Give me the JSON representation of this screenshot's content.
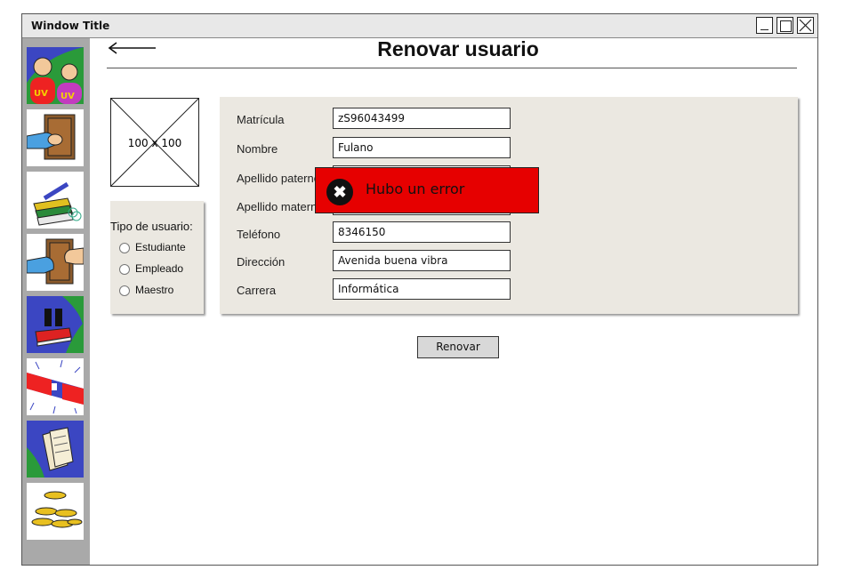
{
  "window": {
    "title": "Window Title"
  },
  "sidebar": {
    "items": [
      {
        "icon": "users-icon"
      },
      {
        "icon": "book-hand-icon"
      },
      {
        "icon": "books-pen-icon"
      },
      {
        "icon": "book-exchange-icon"
      },
      {
        "icon": "pause-book-icon"
      },
      {
        "icon": "alarm-icon"
      },
      {
        "icon": "documents-icon"
      },
      {
        "icon": "coins-icon"
      }
    ]
  },
  "page": {
    "title": "Renovar usuario"
  },
  "image_placeholder": {
    "label": "100 x 100"
  },
  "user_type": {
    "title": "Tipo de usuario:",
    "options": [
      "Estudiante",
      "Empleado",
      "Maestro"
    ]
  },
  "form": {
    "fields": [
      {
        "label": "Matrícula",
        "value": "zS96043499"
      },
      {
        "label": "Nombre",
        "value": "Fulano"
      },
      {
        "label": "Apellido paterno",
        "value": ""
      },
      {
        "label": "Apellido materno",
        "value": ""
      },
      {
        "label": "Teléfono",
        "value": "8346150"
      },
      {
        "label": "Dirección",
        "value": "Avenida buena vibra"
      },
      {
        "label": "Carrera",
        "value": "Informática"
      }
    ]
  },
  "error": {
    "message": "Hubo un error",
    "color": "#e60000"
  },
  "actions": {
    "submit_label": "Renovar"
  }
}
